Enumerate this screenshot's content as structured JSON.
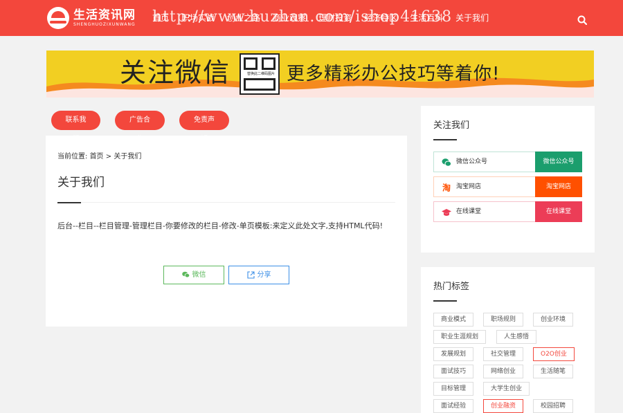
{
  "header": {
    "logo_title": "生活资讯网",
    "logo_subtitle": "SHENGHUOZIXUNWANG",
    "nav_items": [
      "首页",
      "职场实战",
      "创业之路",
      "商业观察",
      "理财投资",
      "经济特区",
      "生活百科",
      "关于我们"
    ],
    "overlay_url": "http://www.huzhan.com/ishop41638"
  },
  "banner": {
    "text_left": "关注微信",
    "qr_hint": "替换此二维码图片",
    "text_right": "更多精彩办公技巧等着你!"
  },
  "pills": [
    "联系我们",
    "广告合作",
    "免责声明"
  ],
  "main": {
    "breadcrumb_prefix": "当前位置:",
    "breadcrumb_home": "首页",
    "breadcrumb_sep": ">",
    "breadcrumb_current": "关于我们",
    "title": "关于我们",
    "content": "后台--栏目--栏目管理-管理栏目-你要修改的栏目-修改-单页模板:来定义此处文字,支持HTML代码!",
    "share_wechat": "微信",
    "share_share": "分享"
  },
  "follow": {
    "title": "关注我们",
    "rows": [
      {
        "label": "微信公众号",
        "button": "微信公众号",
        "color": "#1b9e6d"
      },
      {
        "label": "淘宝网店",
        "button": "淘宝网店",
        "color": "#ff5000"
      },
      {
        "label": "在线课堂",
        "button": "在线课堂",
        "color": "#ec3d57"
      }
    ]
  },
  "tags": {
    "title": "热门标签",
    "items": [
      "商业模式",
      "职场规则",
      "创业环境",
      "职业生涯规划",
      "人生感悟",
      "发展规划",
      "社交管理",
      "O2O创业",
      "面试技巧",
      "网络创业",
      "生活随笔",
      "目标管理",
      "大学生创业",
      "面试经验",
      "创业融资",
      "校园招聘"
    ],
    "highlighted": [
      "O2O创业",
      "创业融资"
    ]
  },
  "colors": {
    "brand": "#f3473c",
    "banner_yellow": "#f2cf22",
    "wechat_green": "#1b9e6d",
    "taobao_orange": "#ff5000",
    "course_red": "#ec3d57",
    "share_blue": "#3a8ee6"
  }
}
